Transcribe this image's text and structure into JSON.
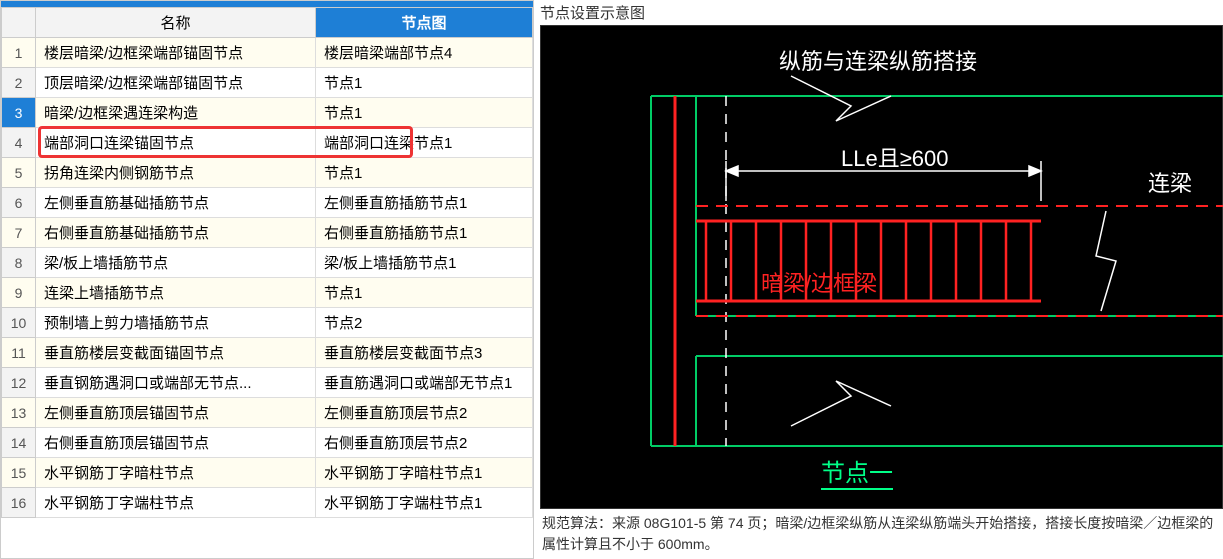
{
  "table": {
    "headers": {
      "name": "名称",
      "node": "节点图"
    },
    "rows": [
      {
        "n": "1",
        "name": "楼层暗梁/边框梁端部锚固节点",
        "node": "楼层暗梁端部节点4"
      },
      {
        "n": "2",
        "name": "顶层暗梁/边框梁端部锚固节点",
        "node": "节点1"
      },
      {
        "n": "3",
        "name": "暗梁/边框梁遇连梁构造",
        "node": "节点1"
      },
      {
        "n": "4",
        "name": "端部洞口连梁锚固节点",
        "node": "端部洞口连梁节点1"
      },
      {
        "n": "5",
        "name": "拐角连梁内侧钢筋节点",
        "node": "节点1"
      },
      {
        "n": "6",
        "name": "左侧垂直筋基础插筋节点",
        "node": "左侧垂直筋插筋节点1"
      },
      {
        "n": "7",
        "name": "右侧垂直筋基础插筋节点",
        "node": "右侧垂直筋插筋节点1"
      },
      {
        "n": "8",
        "name": "梁/板上墙插筋节点",
        "node": "梁/板上墙插筋节点1"
      },
      {
        "n": "9",
        "name": "连梁上墙插筋节点",
        "node": "节点1"
      },
      {
        "n": "10",
        "name": "预制墙上剪力墙插筋节点",
        "node": "节点2"
      },
      {
        "n": "11",
        "name": "垂直筋楼层变截面锚固节点",
        "node": "垂直筋楼层变截面节点3"
      },
      {
        "n": "12",
        "name": "垂直钢筋遇洞口或端部无节点...",
        "node": "垂直筋遇洞口或端部无节点1"
      },
      {
        "n": "13",
        "name": "左侧垂直筋顶层锚固节点",
        "node": "左侧垂直筋顶层节点2"
      },
      {
        "n": "14",
        "name": "右侧垂直筋顶层锚固节点",
        "node": "右侧垂直筋顶层节点2"
      },
      {
        "n": "15",
        "name": "水平钢筋丁字暗柱节点",
        "node": "水平钢筋丁字暗柱节点1"
      },
      {
        "n": "16",
        "name": "水平钢筋丁字端柱节点",
        "node": "水平钢筋丁字端柱节点1"
      }
    ]
  },
  "selected_row": 3,
  "diagram": {
    "title": "节点设置示意图",
    "label_top": "纵筋与连梁纵筋搭接",
    "label_dim": "LLe且≥600",
    "label_right": "连梁",
    "label_bottom": "暗梁/边框梁",
    "label_node": "节点一"
  },
  "footnote": "规范算法：来源 08G101-5 第 74 页；暗梁/边框梁纵筋从连梁纵筋端头开始搭接，搭接长度按暗梁／边框梁的属性计算且不小于 600mm。"
}
